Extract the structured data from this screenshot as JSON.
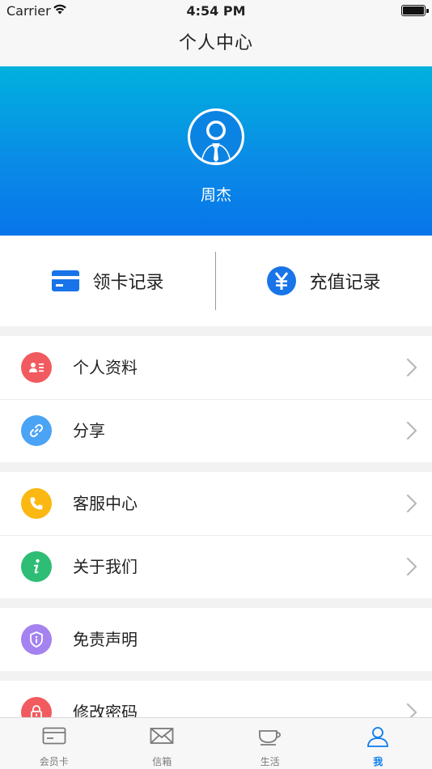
{
  "status_bar": {
    "carrier": "Carrier",
    "time": "4:54 PM"
  },
  "nav": {
    "title": "个人中心"
  },
  "profile": {
    "name": "周杰"
  },
  "records": [
    {
      "label": "领卡记录",
      "icon": "card-icon"
    },
    {
      "label": "充值记录",
      "icon": "yen-icon"
    }
  ],
  "menu": [
    {
      "label": "个人资料",
      "icon": "profile-icon",
      "color": "#f15b5f"
    },
    {
      "label": "分享",
      "icon": "link-icon",
      "color": "#4aa3f5"
    },
    {
      "label": "客服中心",
      "icon": "phone-icon",
      "color": "#fbb813"
    },
    {
      "label": "关于我们",
      "icon": "info-icon",
      "color": "#2ebd74"
    },
    {
      "label": "免责声明",
      "icon": "shield-icon",
      "color": "#a482f0"
    },
    {
      "label": "修改密码",
      "icon": "lock-icon",
      "color": "#f15b5f"
    }
  ],
  "tabs": [
    {
      "label": "会员卡",
      "icon": "card-icon"
    },
    {
      "label": "信箱",
      "icon": "mail-icon"
    },
    {
      "label": "生活",
      "icon": "cup-icon"
    },
    {
      "label": "我",
      "icon": "person-icon",
      "active": true
    }
  ],
  "colors": {
    "accent": "#0a7cf0",
    "hero_top": "#00b1de",
    "hero_bottom": "#0775ea"
  }
}
